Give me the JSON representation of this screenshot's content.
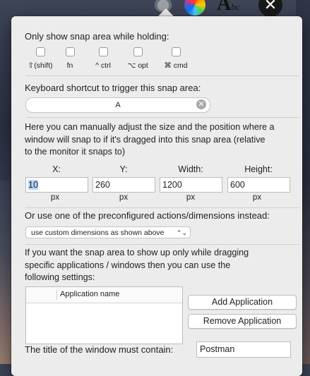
{
  "menubar": {
    "icons": [
      "gear-icon",
      "color-wheel-icon",
      "font-icon",
      "close-icon"
    ],
    "font_icon_text": "A",
    "font_icon_sub": "bc",
    "close_glyph": "✕"
  },
  "modifiers": {
    "title": "Only show snap area while holding:",
    "items": [
      {
        "label": "⇧(shift)",
        "checked": false
      },
      {
        "label": "fn",
        "checked": false
      },
      {
        "label": "^ ctrl",
        "checked": false
      },
      {
        "label": "⌥ opt",
        "checked": false
      },
      {
        "label": "⌘ cmd",
        "checked": false
      }
    ]
  },
  "shortcut": {
    "title": "Keyboard shortcut to trigger this snap area:",
    "value": "A",
    "clear_glyph": "✕"
  },
  "dimensions": {
    "description_lines": [
      "Here you can manually adjust the size and the position where a",
      "window will snap to if it's dragged into this snap area (relative",
      "to the monitor it snaps to)"
    ],
    "x_label": "X:",
    "y_label": "Y:",
    "width_label": "Width:",
    "height_label": "Height:",
    "x_value": "10",
    "y_value": "260",
    "width_value": "1200",
    "height_value": "600",
    "unit": "px"
  },
  "preconfigured": {
    "title": "Or use one of the preconfigured actions/dimensions instead:",
    "selected": "use custom dimensions as shown above"
  },
  "applications": {
    "description_lines": [
      "If you want the snap area to show up only while dragging",
      "specific applications / windows then you can use the",
      "following settings:"
    ],
    "column_header": "Application name",
    "rows": [],
    "add_label": "Add Application",
    "remove_label": "Remove Application"
  },
  "window_title": {
    "label": "The title of the window must contain:",
    "value": "Postman"
  }
}
